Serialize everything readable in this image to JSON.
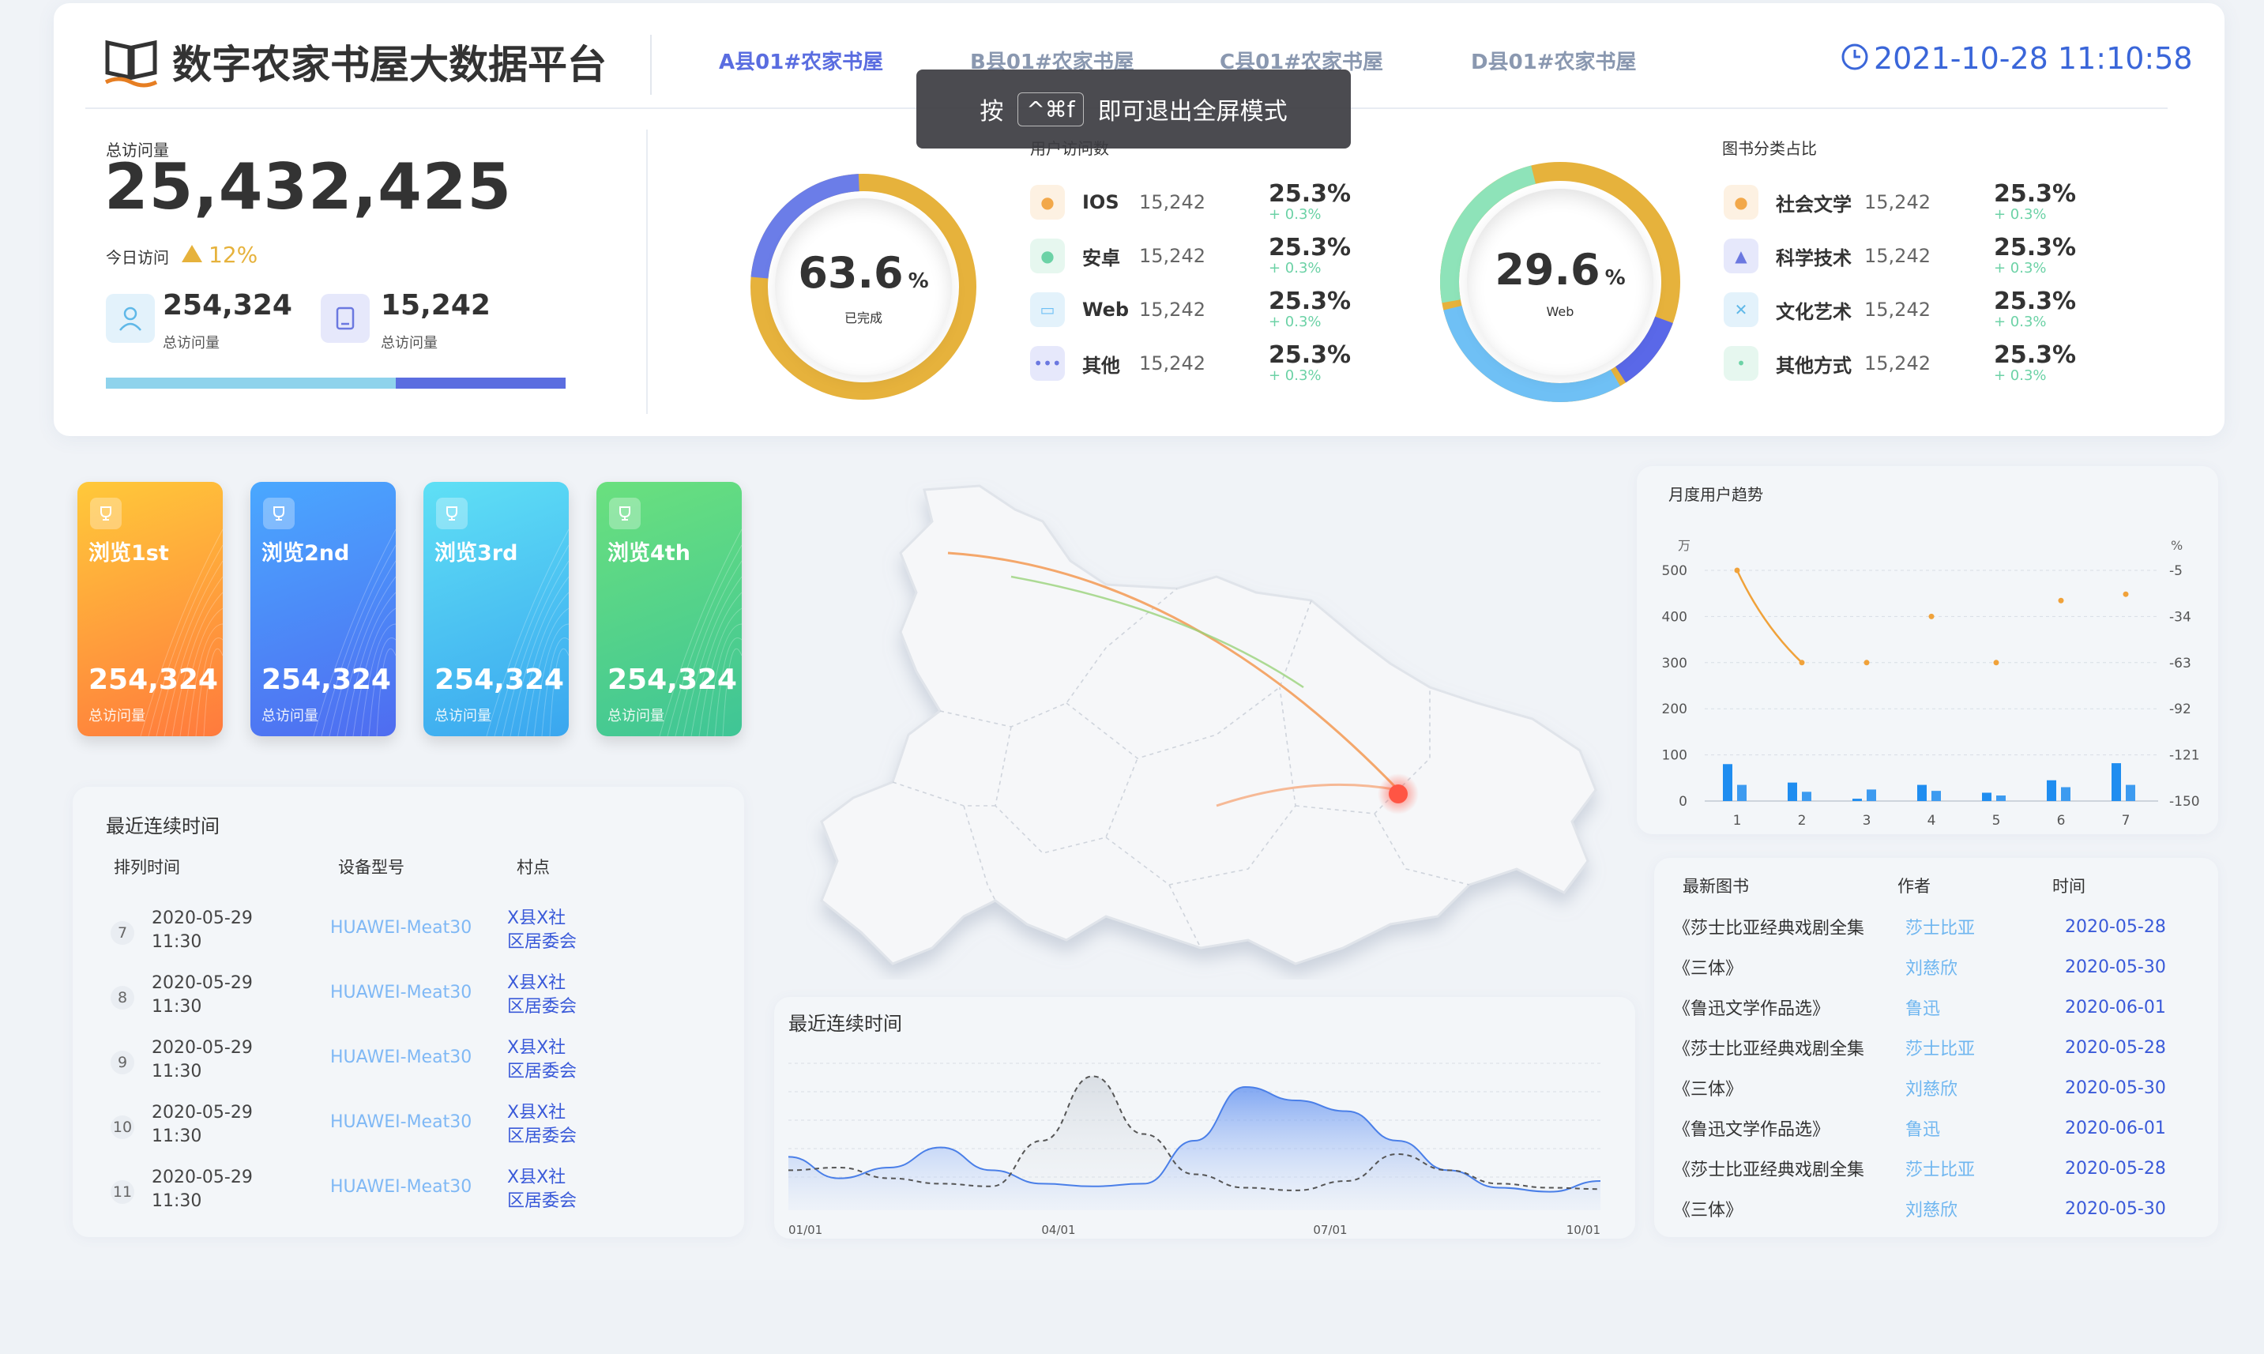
{
  "header": {
    "title": "数字农家书屋大数据平台",
    "tabs": [
      {
        "label": "A县01#农家书屋",
        "active": true
      },
      {
        "label": "B县01#农家书屋",
        "active": false
      },
      {
        "label": "C县01#农家书屋",
        "active": false
      },
      {
        "label": "D县01#农家书屋",
        "active": false
      }
    ],
    "datetime": "2021-10-28 11:10:58"
  },
  "toast": {
    "prefix": "按",
    "key": "^⌘f",
    "suffix": "即可退出全屏模式"
  },
  "overview": {
    "total_label": "总访问量",
    "total_value": "25,432,425",
    "today_label": "今日访问",
    "today_change": "12%",
    "stat1_value": "254,324",
    "stat1_label": "总访问量",
    "stat2_value": "15,242",
    "stat2_label": "总访问量",
    "progress_fraction": 0.63
  },
  "user_visits": {
    "title": "用户访问数",
    "ring_value": "63.6",
    "ring_unit": "%",
    "ring_label": "已完成",
    "rows": [
      {
        "name": "IOS",
        "num": "15,242",
        "pct": "25.3%",
        "chg": "+ 0.3%"
      },
      {
        "name": "安卓",
        "num": "15,242",
        "pct": "25.3%",
        "chg": "+ 0.3%"
      },
      {
        "name": "Web",
        "num": "15,242",
        "pct": "25.3%",
        "chg": "+ 0.3%"
      },
      {
        "name": "其他",
        "num": "15,242",
        "pct": "25.3%",
        "chg": "+ 0.3%"
      }
    ]
  },
  "book_category": {
    "title": "图书分类占比",
    "ring_value": "29.6",
    "ring_unit": "%",
    "ring_label": "Web",
    "rows": [
      {
        "name": "社会文学",
        "num": "15,242",
        "pct": "25.3%",
        "chg": "+ 0.3%"
      },
      {
        "name": "科学技术",
        "num": "15,242",
        "pct": "25.3%",
        "chg": "+ 0.3%"
      },
      {
        "name": "文化艺术",
        "num": "15,242",
        "pct": "25.3%",
        "chg": "+ 0.3%"
      },
      {
        "name": "其他方式",
        "num": "15,242",
        "pct": "25.3%",
        "chg": "+ 0.3%"
      }
    ]
  },
  "ranks": [
    {
      "title": "浏览1st",
      "value": "254,324",
      "label": "总访问量"
    },
    {
      "title": "浏览2nd",
      "value": "254,324",
      "label": "总访问量"
    },
    {
      "title": "浏览3rd",
      "value": "254,324",
      "label": "总访问量"
    },
    {
      "title": "浏览4th",
      "value": "254,324",
      "label": "总访问量"
    }
  ],
  "recent": {
    "title": "最近连续时间",
    "headers": [
      "排列时间",
      "设备型号",
      "村点"
    ],
    "rows": [
      {
        "no": "7",
        "date": "2020-05-29",
        "time": "11:30",
        "device": "HUAWEI-Meat30",
        "village1": "X县X社",
        "village2": "区居委会"
      },
      {
        "no": "8",
        "date": "2020-05-29",
        "time": "11:30",
        "device": "HUAWEI-Meat30",
        "village1": "X县X社",
        "village2": "区居委会"
      },
      {
        "no": "9",
        "date": "2020-05-29",
        "time": "11:30",
        "device": "HUAWEI-Meat30",
        "village1": "X县X社",
        "village2": "区居委会"
      },
      {
        "no": "10",
        "date": "2020-05-29",
        "time": "11:30",
        "device": "HUAWEI-Meat30",
        "village1": "X县X社",
        "village2": "区居委会"
      },
      {
        "no": "11",
        "date": "2020-05-29",
        "time": "11:30",
        "device": "HUAWEI-Meat30",
        "village1": "X县X社",
        "village2": "区居委会"
      }
    ]
  },
  "monthly": {
    "title": "月度用户趋势",
    "left_unit": "万",
    "right_unit": "%",
    "left_ticks": [
      "500",
      "400",
      "300",
      "200",
      "100",
      "0"
    ],
    "right_ticks": [
      "-5",
      "-34",
      "-63",
      "-92",
      "-121",
      "-150"
    ],
    "x_ticks": [
      "1",
      "2",
      "3",
      "4",
      "5",
      "6",
      "7"
    ]
  },
  "area_chart": {
    "title": "最近连续时间",
    "x_ticks": [
      "01/01",
      "04/01",
      "07/01",
      "10/01"
    ]
  },
  "books": {
    "headers": [
      "最新图书",
      "作者",
      "时间"
    ],
    "rows": [
      {
        "title": "《莎士比亚经典戏剧全集",
        "author": "莎士比亚",
        "date": "2020-05-28"
      },
      {
        "title": "《三体》",
        "author": "刘慈欣",
        "date": "2020-05-30"
      },
      {
        "title": "《鲁迅文学作品选》",
        "author": "鲁迅",
        "date": "2020-06-01"
      },
      {
        "title": "《莎士比亚经典戏剧全集",
        "author": "莎士比亚",
        "date": "2020-05-28"
      },
      {
        "title": "《三体》",
        "author": "刘慈欣",
        "date": "2020-05-30"
      },
      {
        "title": "《鲁迅文学作品选》",
        "author": "鲁迅",
        "date": "2020-06-01"
      },
      {
        "title": "《莎士比亚经典戏剧全集",
        "author": "莎士比亚",
        "date": "2020-05-28"
      },
      {
        "title": "《三体》",
        "author": "刘慈欣",
        "date": "2020-05-30"
      }
    ]
  },
  "chart_data": [
    {
      "type": "bar",
      "title": "月度用户趋势",
      "x": [
        1,
        2,
        3,
        4,
        5,
        6,
        7
      ],
      "ylim": [
        0,
        500
      ],
      "y2lim": [
        -150,
        -5
      ],
      "series": [
        {
          "values": [
            80,
            40,
            5,
            35,
            18,
            45,
            82
          ]
        },
        {
          "values": [
            35,
            20,
            25,
            22,
            12,
            30,
            35
          ]
        },
        {
          "type": "line",
          "values": [
            -5,
            -63,
            -63,
            -34,
            -63,
            -24,
            -20
          ]
        }
      ]
    },
    {
      "type": "area",
      "title": "最近连续时间",
      "x_ticks": [
        "01/01",
        "04/01",
        "07/01",
        "10/01"
      ],
      "ylim": [
        0,
        100
      ],
      "series": [
        {
          "values": [
            28,
            12,
            20,
            35,
            18,
            8,
            6,
            8,
            40,
            80,
            70,
            62,
            40,
            18,
            5,
            2,
            10
          ]
        },
        {
          "values": [
            18,
            20,
            12,
            8,
            6,
            40,
            88,
            45,
            15,
            5,
            3,
            10,
            30,
            18,
            8,
            5,
            4
          ]
        }
      ]
    }
  ]
}
